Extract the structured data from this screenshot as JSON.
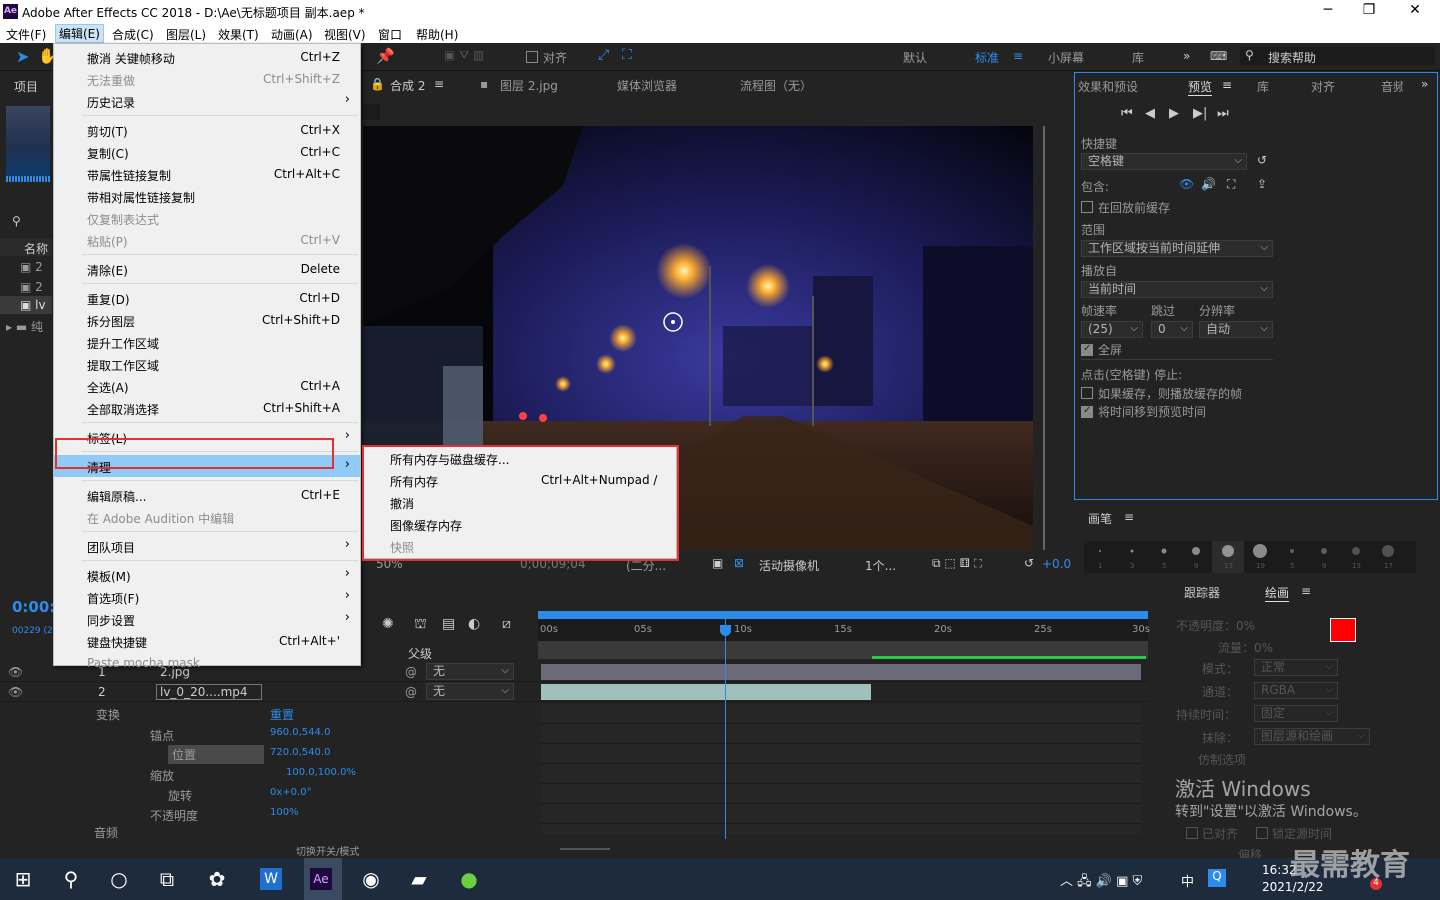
{
  "window": {
    "title": "Adobe After Effects CC 2018 - D:\\Ae\\无标题项目 副本.aep *",
    "logo": "Ae"
  },
  "menubar": [
    "文件(F)",
    "编辑(E)",
    "合成(C)",
    "图层(L)",
    "效果(T)",
    "动画(A)",
    "视图(V)",
    "窗口",
    "帮助(H)"
  ],
  "toolbar": {
    "snap_label": "对齐",
    "workspaces": [
      "默认",
      "标准",
      "小屏幕",
      "库"
    ],
    "search_placeholder": "搜索帮助"
  },
  "edit_menu": [
    {
      "label": "撤消 关键帧移动",
      "shortcut": "Ctrl+Z"
    },
    {
      "label": "无法重做",
      "shortcut": "Ctrl+Shift+Z",
      "disabled": true
    },
    {
      "label": "历史记录",
      "shortcut": "",
      "submenu": true
    },
    {
      "label": "剪切(T)",
      "shortcut": "Ctrl+X"
    },
    {
      "label": "复制(C)",
      "shortcut": "Ctrl+C"
    },
    {
      "label": "带属性链接复制",
      "shortcut": "Ctrl+Alt+C"
    },
    {
      "label": "带相对属性链接复制",
      "shortcut": ""
    },
    {
      "label": "仅复制表达式",
      "shortcut": "",
      "disabled": true
    },
    {
      "label": "粘贴(P)",
      "shortcut": "Ctrl+V",
      "disabled": true
    },
    {
      "label": "清除(E)",
      "shortcut": "Delete"
    },
    {
      "label": "重复(D)",
      "shortcut": "Ctrl+D"
    },
    {
      "label": "拆分图层",
      "shortcut": "Ctrl+Shift+D"
    },
    {
      "label": "提升工作区域",
      "shortcut": ""
    },
    {
      "label": "提取工作区域",
      "shortcut": ""
    },
    {
      "label": "全选(A)",
      "shortcut": "Ctrl+A"
    },
    {
      "label": "全部取消选择",
      "shortcut": "Ctrl+Shift+A"
    },
    {
      "label": "标签(L)",
      "shortcut": "",
      "submenu": true
    },
    {
      "label": "清理",
      "shortcut": "",
      "submenu": true,
      "highlighted": true
    },
    {
      "label": "编辑原稿...",
      "shortcut": "Ctrl+E"
    },
    {
      "label": "在 Adobe Audition 中编辑",
      "shortcut": "",
      "disabled": true
    },
    {
      "label": "团队项目",
      "shortcut": "",
      "submenu": true
    },
    {
      "label": "模板(M)",
      "shortcut": "",
      "submenu": true
    },
    {
      "label": "首选项(F)",
      "shortcut": "",
      "submenu": true
    },
    {
      "label": "同步设置",
      "shortcut": "",
      "submenu": true
    },
    {
      "label": "键盘快捷键",
      "shortcut": "Ctrl+Alt+'"
    },
    {
      "label": "Paste mocha mask",
      "shortcut": "",
      "disabled": true
    }
  ],
  "purge_submenu": [
    {
      "label": "所有内存与磁盘缓存...",
      "shortcut": ""
    },
    {
      "label": "所有内存",
      "shortcut": "Ctrl+Alt+Numpad /"
    },
    {
      "label": "撤消",
      "shortcut": ""
    },
    {
      "label": "图像缓存内存",
      "shortcut": ""
    },
    {
      "label": "快照",
      "shortcut": "",
      "disabled": true
    }
  ],
  "left_panel": {
    "title": "项目",
    "col_name": "名称"
  },
  "comp_tabs": {
    "comp": "合成 2",
    "layer": "图层 2.jpg",
    "media": "媒体浏览器",
    "flow": "流程图（无）"
  },
  "viewer_bar": {
    "zoom": "50%",
    "timecode": "0;00;09;04",
    "res": "(二分...",
    "camera": "活动摄像机",
    "views": "1个...",
    "exposure": "+0.0"
  },
  "preview_panel": {
    "tabs": [
      "效果和预设",
      "预览",
      "库",
      "对齐",
      "音频"
    ],
    "shortcut_label": "快捷键",
    "shortcut_value": "空格键",
    "include_label": "包含:",
    "cache_before": "在回放前缓存",
    "range_label": "范围",
    "range_value": "工作区域按当前时间延伸",
    "play_from_label": "播放自",
    "play_from_value": "当前时间",
    "fps_label": "帧速率",
    "skip_label": "跳过",
    "res_label": "分辨率",
    "fps_value": "(25)",
    "skip_value": "0",
    "res_value": "自动",
    "fullscreen": "全屏",
    "stop_label": "点击(空格键) 停止:",
    "if_cache": "如果缓存，则播放缓存的帧",
    "move_time": "将时间移到预览时间"
  },
  "brush_panel": {
    "title": "画笔",
    "sizes": [
      "1",
      "3",
      "5",
      "9",
      "13",
      "19",
      "5",
      "9",
      "13",
      "17"
    ]
  },
  "timeline": {
    "timecode": "0:00:",
    "frames": "00229 (2",
    "parent_label": "父级",
    "ruler": [
      "00s",
      "05s",
      "10s",
      "15s",
      "20s",
      "25s",
      "30s"
    ],
    "layers": [
      {
        "num": "1",
        "name": "2.jpg",
        "parent": "无"
      },
      {
        "num": "2",
        "name": "lv_0_20....mp4",
        "parent": "无"
      }
    ],
    "transform_label": "变换",
    "reset_label": "重置",
    "props": [
      {
        "name": "锚点",
        "value": "960.0,544.0"
      },
      {
        "name": "位置",
        "value": "720.0,540.0"
      },
      {
        "name": "缩放",
        "value": "100.0,100.0%"
      },
      {
        "name": "旋转",
        "value": "0x+0.0°"
      },
      {
        "name": "不透明度",
        "value": "100%"
      }
    ],
    "audio_label": "音频",
    "toggle_label": "切换开关/模式"
  },
  "tracker_paint": {
    "tracker": "跟踪器",
    "paint": "绘画",
    "opacity": "不透明度：0%",
    "flow": "流量：0%",
    "mode_label": "模式：",
    "mode": "正常",
    "channel_label": "通道：",
    "channel": "RGBA",
    "duration_label": "持续时间：",
    "duration": "固定",
    "erase_label": "抹除：",
    "erase": "图层源和绘画",
    "clone_label": "仿制选项",
    "aligned": "已对齐",
    "lock_time": "锁定源时间",
    "offset": "偏移"
  },
  "watermark": {
    "line1": "激活 Windows",
    "line2": "转到\"设置\"以激活 Windows。",
    "brand": "最需教育"
  },
  "taskbar": {
    "time": "16:32",
    "date": "2021/2/22",
    "ime": "中",
    "badge": "4"
  },
  "colors": {
    "accent": "#2d8ceb",
    "highlight": "#91c9f7",
    "redbox": "#e53030",
    "fg_swatch": "#ff0000"
  }
}
